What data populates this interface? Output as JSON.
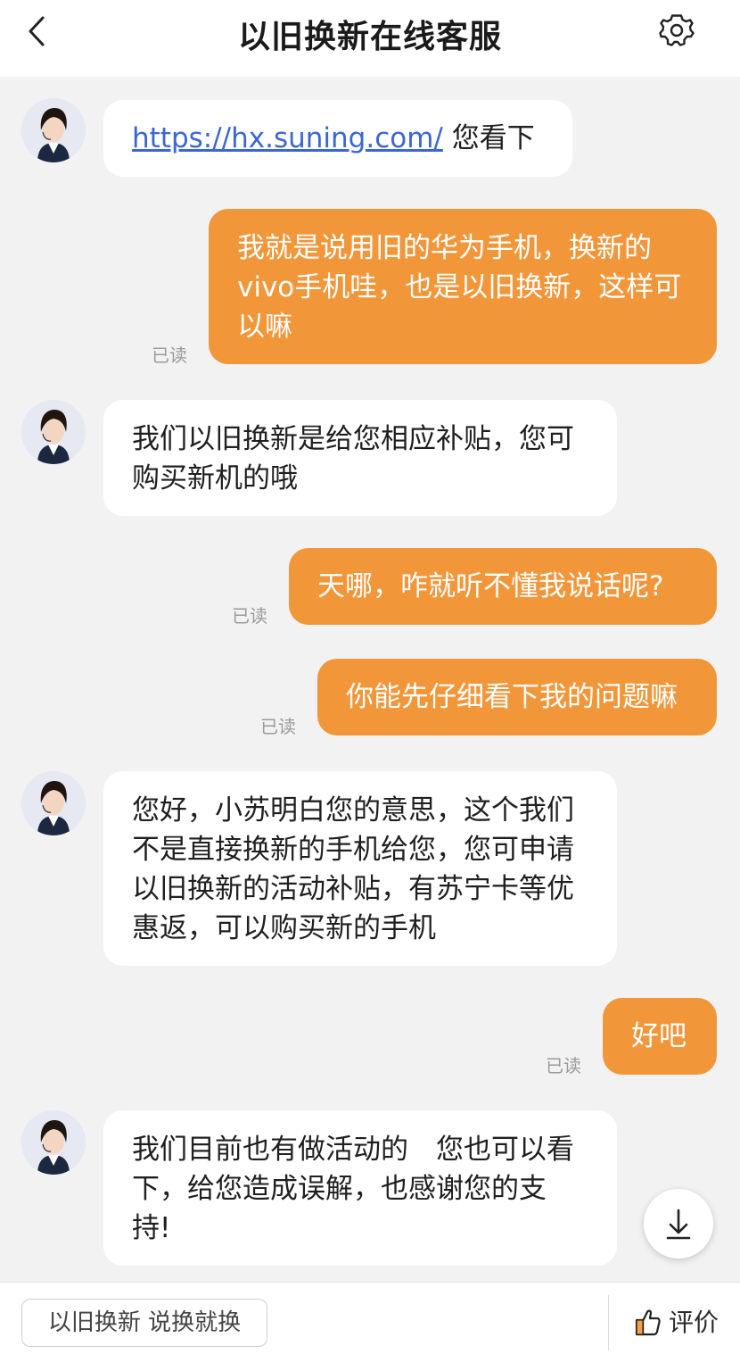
{
  "header": {
    "title": "以旧换新在线客服"
  },
  "messages": [
    {
      "side": "left",
      "link_text": "https://hx.suning.com/",
      "text": " 您看下"
    },
    {
      "side": "right",
      "lines": [
        "我就是说用旧的华为手机，换新的",
        "vivo手机哇，也是以旧换新，这样可",
        "以嘛"
      ],
      "status": "已读"
    },
    {
      "side": "left",
      "lines": [
        "我们以旧换新是给您相应补贴，您可",
        "购买新机的哦"
      ]
    },
    {
      "side": "right",
      "lines": [
        "天哪，咋就听不懂我说话呢?"
      ],
      "status": "已读"
    },
    {
      "side": "right",
      "lines": [
        "你能先仔细看下我的问题嘛"
      ],
      "status": "已读"
    },
    {
      "side": "left",
      "lines": [
        "您好，小苏明白您的意思，这个我们",
        "不是直接换新的手机给您，您可申请",
        "以旧换新的活动补贴，有苏宁卡等优",
        "惠返，可以购买新的手机"
      ]
    },
    {
      "side": "right",
      "lines": [
        "好吧"
      ],
      "status": "已读"
    },
    {
      "side": "left",
      "lines": [
        "我们目前也有做活动的　您也可以看",
        "下，给您造成误解，也感谢您的支",
        "持!"
      ]
    }
  ],
  "footer": {
    "quick_reply": "以旧换新 说换就换",
    "rate_label": "评价"
  },
  "icons": {
    "back": "chevron-left-icon",
    "settings": "gear-icon",
    "scroll_down": "download-arrow-icon",
    "rate": "thumbs-up-icon"
  },
  "colors": {
    "user_bubble": "#f2963a",
    "agent_bubble": "#ffffff",
    "background": "#f2f2f2",
    "link": "#3a66d6"
  }
}
